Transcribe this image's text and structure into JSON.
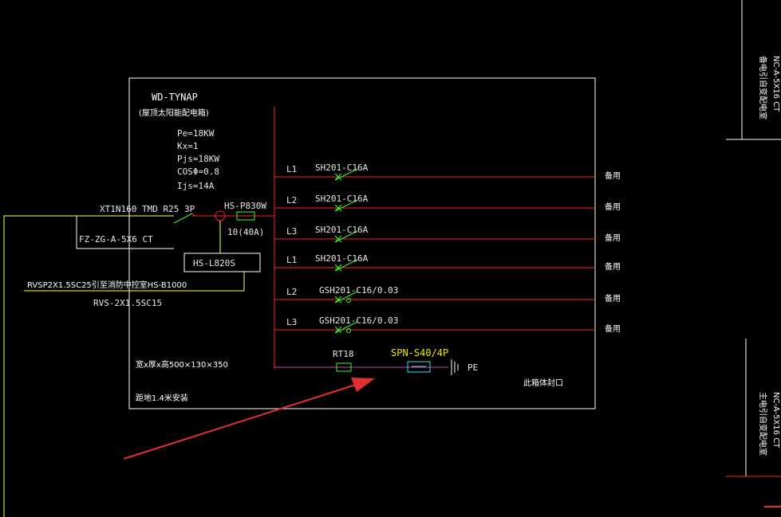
{
  "colors": {
    "background": "#000000",
    "frame": "#ffffff",
    "busbar": "#ff2020",
    "breaker_symbol": "#30ff30",
    "feeder_yellow": "#ffff40",
    "spd_line": "#c040c0",
    "annotation_arrow": "#e03030",
    "cyan": "#40e0e0"
  },
  "panel": {
    "name": "WD-TYNAP",
    "subtitle": "(屋顶太阳能配电箱)",
    "params": [
      "Pe=18KW",
      "Kx=1",
      "Pjs=18KW",
      "COSΦ=0.8",
      "Ijs=14A"
    ],
    "dimensions": "宽x厚x高500×130×350",
    "mounting": "距地1.4米安装",
    "note": "此箱体封口"
  },
  "incoming": {
    "breaker": "XT1N160 TMD R25 3P",
    "cable": "FZ-ZG-A-5X6 CT",
    "meter": "HS-P830W",
    "meter_rating": "10(40A)",
    "controller": "HS-L820S",
    "control_cable_1": "RVSP2X1.5SC25引至消防中控室HS-B1000",
    "control_cable_2": "RVS-2X1.5SC15"
  },
  "circuits": [
    {
      "phase": "L1",
      "breaker": "SH201-C16A",
      "load": "备用"
    },
    {
      "phase": "L2",
      "breaker": "SH201-C16A",
      "load": "备用"
    },
    {
      "phase": "L3",
      "breaker": "SH201-C16A",
      "load": "备用"
    },
    {
      "phase": "L1",
      "breaker": "SH201-C16A",
      "load": "备用"
    },
    {
      "phase": "L2",
      "breaker": "GSH201-C16/0.03",
      "load": "备用"
    },
    {
      "phase": "L3",
      "breaker": "GSH201-C16/0.03",
      "load": "备用"
    }
  ],
  "spd": {
    "fuse": "RT18",
    "device": "SPN-S40/4P",
    "ground": "PE"
  },
  "right_margin": {
    "text_upper": "备电引自变配电室",
    "text_lower": "主电引自变配电室",
    "cable_upper": "NC-A-5X16 CT",
    "cable_lower": "NC-A-5X16 CT"
  }
}
